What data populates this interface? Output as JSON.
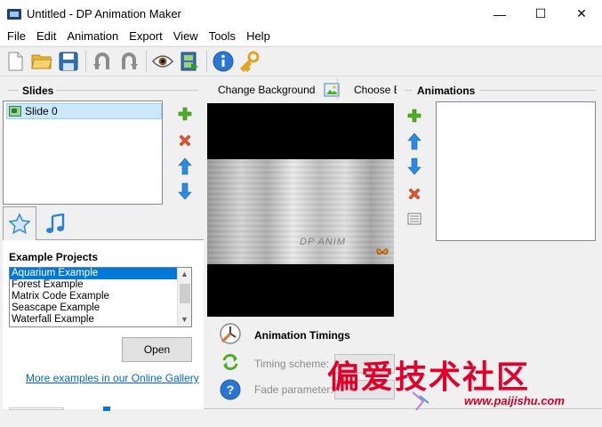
{
  "window": {
    "title": "Untitled - DP Animation Maker",
    "minimize": "—",
    "maximize": "☐",
    "close": "✕"
  },
  "menu": [
    "File",
    "Edit",
    "Animation",
    "Export",
    "View",
    "Tools",
    "Help"
  ],
  "toolbar": {
    "groups": [
      [
        "new-file-icon",
        "open-folder-icon",
        "save-icon"
      ],
      [
        "undo-icon",
        "redo-icon"
      ],
      [
        "preview-eye-icon",
        "export-video-icon"
      ],
      [
        "info-icon",
        "key-icon"
      ]
    ]
  },
  "slides": {
    "title": "Slides",
    "items": [
      {
        "label": "Slide 0"
      }
    ]
  },
  "tabs": [
    {
      "icon": "star-icon",
      "selected": true
    },
    {
      "icon": "music-note-icon",
      "selected": false
    }
  ],
  "examples": {
    "title": "Example Projects",
    "items": [
      "Aquarium Example",
      "Forest Example",
      "Matrix Code Example",
      "Seascape Example",
      "Waterfall Example"
    ],
    "selected_index": 0,
    "open_label": "Open",
    "gallery_link": "More examples in our Online Gallery"
  },
  "center": {
    "change_background": "Change Background",
    "choose_effect": "Choose E",
    "preview_watermark": "DP ANIM",
    "timings_title": "Animation Timings",
    "timing_scheme_label": "Timing scheme:",
    "fade_parameter_label": "Fade parameter:"
  },
  "animations": {
    "title": "Animations"
  },
  "overlay": {
    "site_name": "偏爱技术社区",
    "site_url": "www.paijishu.com"
  },
  "colors": {
    "accent": "#0078d7",
    "selection_bg": "#cce8ff",
    "add_green": "#4caf1f",
    "delete_orange": "#e8552b",
    "arrow_blue": "#2d8ae0",
    "watermark_red": "#e0002a"
  }
}
